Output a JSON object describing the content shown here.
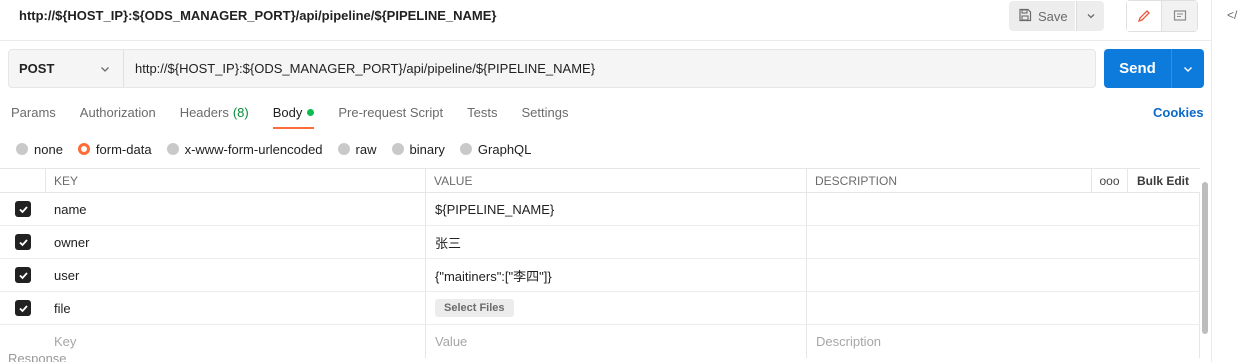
{
  "request": {
    "title": "http://${HOST_IP}:${ODS_MANAGER_PORT}/api/pipeline/${PIPELINE_NAME}",
    "method": "POST",
    "url": "http://${HOST_IP}:${ODS_MANAGER_PORT}/api/pipeline/${PIPELINE_NAME}"
  },
  "toolbar": {
    "save_label": "Save",
    "send_label": "Send"
  },
  "tabs": [
    {
      "label": "Params"
    },
    {
      "label": "Authorization"
    },
    {
      "label": "Headers",
      "count": "(8)"
    },
    {
      "label": "Body",
      "active": true
    },
    {
      "label": "Pre-request Script"
    },
    {
      "label": "Tests"
    },
    {
      "label": "Settings"
    }
  ],
  "cookies_label": "Cookies",
  "body_types": [
    {
      "label": "none"
    },
    {
      "label": "form-data",
      "selected": true
    },
    {
      "label": "x-www-form-urlencoded"
    },
    {
      "label": "raw"
    },
    {
      "label": "binary"
    },
    {
      "label": "GraphQL"
    }
  ],
  "table": {
    "headers": {
      "key": "KEY",
      "value": "VALUE",
      "description": "DESCRIPTION",
      "more": "ooo",
      "bulk_edit": "Bulk Edit"
    },
    "rows": [
      {
        "key": "name",
        "value": "${PIPELINE_NAME}",
        "checked": true
      },
      {
        "key": "owner",
        "value": "张三",
        "checked": true
      },
      {
        "key": "user",
        "value": "{\"maitiners\":[\"李四\"]}",
        "checked": true
      },
      {
        "key": "file",
        "file_button": "Select Files",
        "checked": true
      }
    ],
    "placeholders": {
      "key": "Key",
      "value": "Value",
      "description": "Description"
    }
  },
  "response_label": "Response",
  "colors": {
    "accent": "#ff6c37",
    "send": "#0c7bdc",
    "link": "#0b6ac9",
    "status_dot": "#0cbb52"
  }
}
